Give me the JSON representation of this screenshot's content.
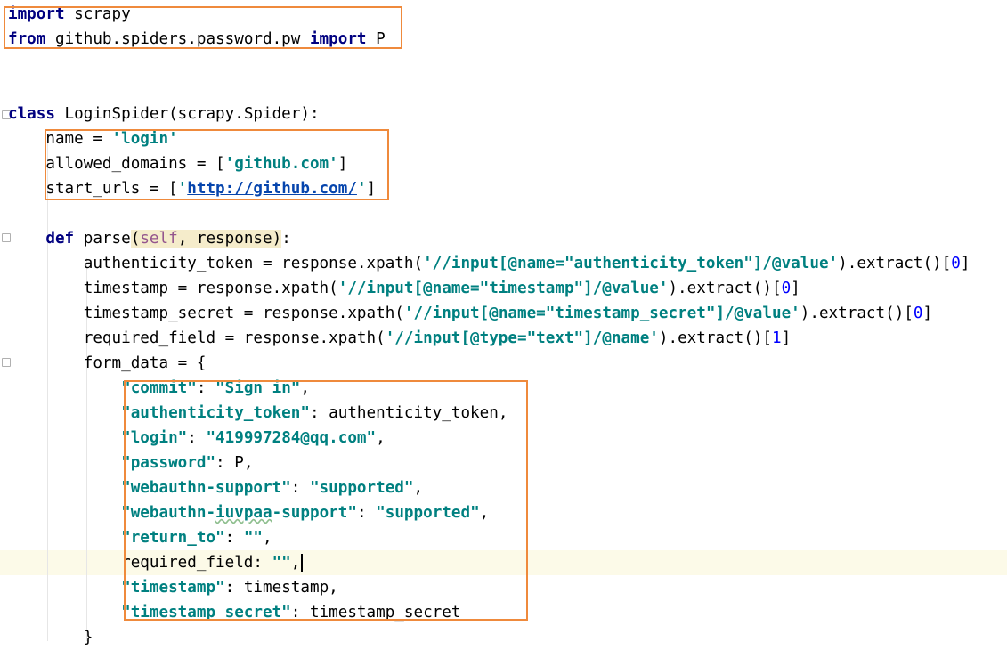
{
  "code_lines": [
    {
      "id": "l1",
      "tokens": [
        {
          "t": "import",
          "c": "kw"
        },
        {
          "t": " scrapy"
        }
      ]
    },
    {
      "id": "l2",
      "tokens": [
        {
          "t": "from",
          "c": "kw"
        },
        {
          "t": " github.spiders.password.pw "
        },
        {
          "t": "import",
          "c": "kw"
        },
        {
          "t": " P"
        }
      ]
    },
    {
      "id": "l3",
      "tokens": []
    },
    {
      "id": "l4",
      "tokens": []
    },
    {
      "id": "l5",
      "tokens": [
        {
          "t": "class",
          "c": "kw"
        },
        {
          "t": " LoginSpider(scrapy.Spider):"
        }
      ]
    },
    {
      "id": "l6",
      "tokens": [
        {
          "t": "    name = "
        },
        {
          "t": "'login'",
          "c": "str"
        }
      ]
    },
    {
      "id": "l7",
      "tokens": [
        {
          "t": "    allowed_domains = ["
        },
        {
          "t": "'github.com'",
          "c": "str"
        },
        {
          "t": "]"
        }
      ]
    },
    {
      "id": "l8",
      "tokens": [
        {
          "t": "    start_urls = ["
        },
        {
          "t": "'",
          "c": "str"
        },
        {
          "t": "http://github.com/",
          "c": "url"
        },
        {
          "t": "'",
          "c": "str"
        },
        {
          "t": "]"
        }
      ]
    },
    {
      "id": "l9",
      "tokens": []
    },
    {
      "id": "l10",
      "tokens": [
        {
          "t": "    "
        },
        {
          "t": "def",
          "c": "kw"
        },
        {
          "t": " parse"
        },
        {
          "t": "(",
          "c": "paren"
        },
        {
          "t": "self",
          "c": "self"
        },
        {
          "t": ", response",
          "c": "paren"
        },
        {
          "t": ")",
          "c": "paren"
        },
        {
          "t": ":"
        }
      ]
    },
    {
      "id": "l11",
      "tokens": [
        {
          "t": "        authenticity_token = response.xpath("
        },
        {
          "t": "'//input[@name=\"authenticity_token\"]/@value'",
          "c": "str"
        },
        {
          "t": ").extract()["
        },
        {
          "t": "0",
          "c": "num"
        },
        {
          "t": "]"
        }
      ]
    },
    {
      "id": "l12",
      "tokens": [
        {
          "t": "        timestamp = response.xpath("
        },
        {
          "t": "'//input[@name=\"timestamp\"]/@value'",
          "c": "str"
        },
        {
          "t": ").extract()["
        },
        {
          "t": "0",
          "c": "num"
        },
        {
          "t": "]"
        }
      ]
    },
    {
      "id": "l13",
      "tokens": [
        {
          "t": "        timestamp_secret = response.xpath("
        },
        {
          "t": "'//input[@name=\"timestamp_secret\"]/@value'",
          "c": "str"
        },
        {
          "t": ").extract()["
        },
        {
          "t": "0",
          "c": "num"
        },
        {
          "t": "]"
        }
      ]
    },
    {
      "id": "l14",
      "tokens": [
        {
          "t": "        required_field = response.xpath("
        },
        {
          "t": "'//input[@type=\"text\"]/@name'",
          "c": "str"
        },
        {
          "t": ").extract()["
        },
        {
          "t": "1",
          "c": "num"
        },
        {
          "t": "]"
        }
      ]
    },
    {
      "id": "l15",
      "tokens": [
        {
          "t": "        form_data = {"
        }
      ]
    },
    {
      "id": "l16",
      "tokens": [
        {
          "t": "            "
        },
        {
          "t": "\"commit\"",
          "c": "str"
        },
        {
          "t": ": "
        },
        {
          "t": "\"Sign in\"",
          "c": "str"
        },
        {
          "t": ","
        }
      ]
    },
    {
      "id": "l17",
      "tokens": [
        {
          "t": "            "
        },
        {
          "t": "\"authenticity_token\"",
          "c": "str"
        },
        {
          "t": ": authenticity_token,"
        }
      ]
    },
    {
      "id": "l18",
      "tokens": [
        {
          "t": "            "
        },
        {
          "t": "\"login\"",
          "c": "str"
        },
        {
          "t": ": "
        },
        {
          "t": "\"419997284@qq.com\"",
          "c": "str"
        },
        {
          "t": ","
        }
      ]
    },
    {
      "id": "l19",
      "tokens": [
        {
          "t": "            "
        },
        {
          "t": "\"password\"",
          "c": "str"
        },
        {
          "t": ": P,"
        }
      ]
    },
    {
      "id": "l20",
      "tokens": [
        {
          "t": "            "
        },
        {
          "t": "\"webauthn-support\"",
          "c": "str"
        },
        {
          "t": ": "
        },
        {
          "t": "\"supported\"",
          "c": "str"
        },
        {
          "t": ","
        }
      ]
    },
    {
      "id": "l21",
      "tokens": [
        {
          "t": "            "
        },
        {
          "t": "\"webauthn-",
          "c": "str"
        },
        {
          "t": "iuvpaa",
          "c": "strwavy"
        },
        {
          "t": "-support\"",
          "c": "str"
        },
        {
          "t": ": "
        },
        {
          "t": "\"supported\"",
          "c": "str"
        },
        {
          "t": ","
        }
      ]
    },
    {
      "id": "l22",
      "tokens": [
        {
          "t": "            "
        },
        {
          "t": "\"return_to\"",
          "c": "str"
        },
        {
          "t": ": "
        },
        {
          "t": "\"\"",
          "c": "str"
        },
        {
          "t": ","
        }
      ]
    },
    {
      "id": "l23",
      "tokens": [
        {
          "t": "            required_field: "
        },
        {
          "t": "\"\"",
          "c": "str"
        },
        {
          "t": ","
        },
        {
          "t": "",
          "c": "caret"
        }
      ]
    },
    {
      "id": "l24",
      "tokens": [
        {
          "t": "            "
        },
        {
          "t": "\"timestamp\"",
          "c": "str"
        },
        {
          "t": ": timestamp,"
        }
      ]
    },
    {
      "id": "l25",
      "tokens": [
        {
          "t": "            "
        },
        {
          "t": "\"timestamp_secret\"",
          "c": "str"
        },
        {
          "t": ": timestamp_secret"
        }
      ]
    },
    {
      "id": "l26",
      "tokens": [
        {
          "t": "        }"
        }
      ]
    }
  ],
  "caret_line": 23,
  "colors": {
    "keyword": "#000080",
    "string": "#008080",
    "number": "#0000ff",
    "self": "#94558d",
    "highlight_box": "#ef8a3c",
    "caret_row": "#fcfae8"
  }
}
